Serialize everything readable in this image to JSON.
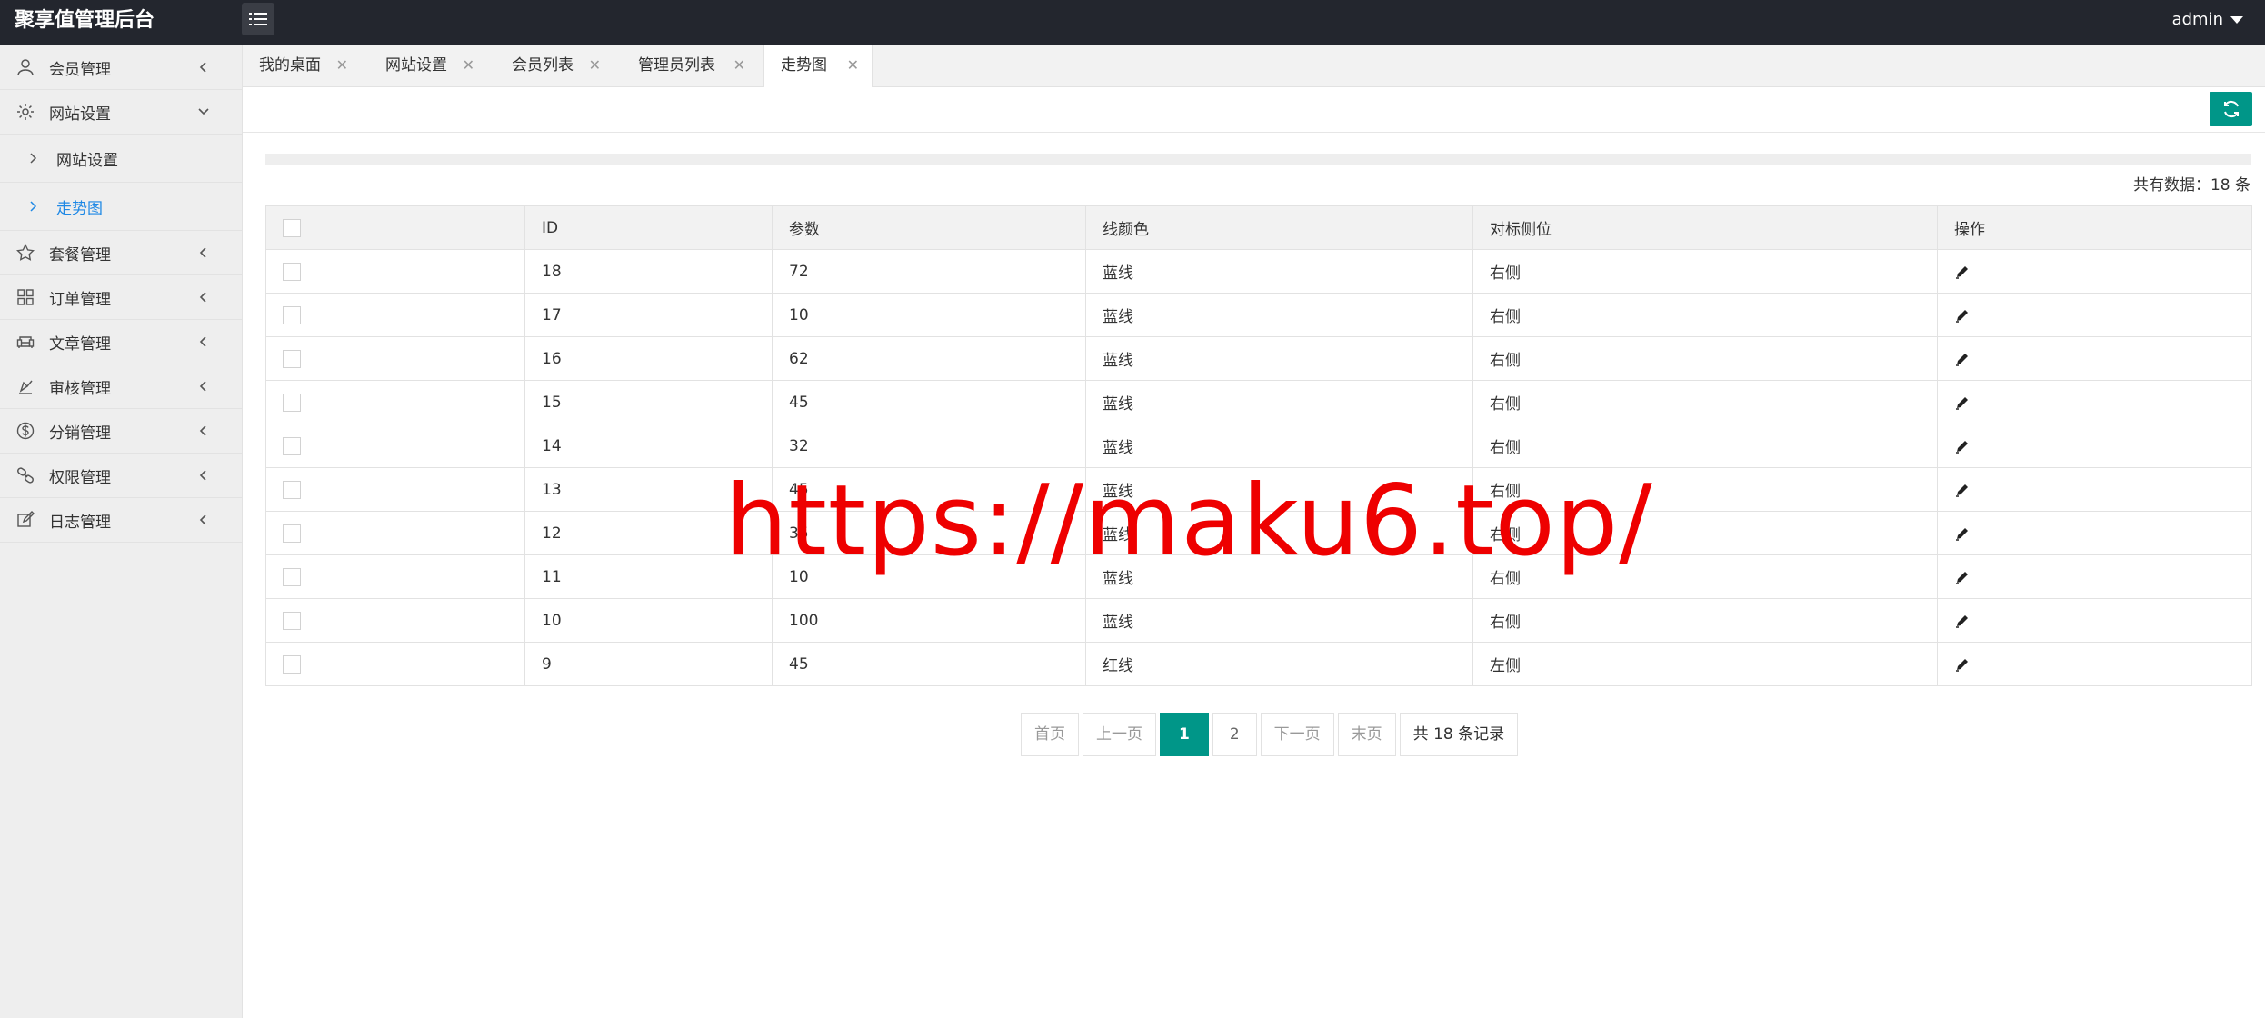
{
  "header": {
    "title": "聚享值管理后台",
    "user": "admin"
  },
  "sidebar": {
    "items": [
      {
        "label": "会员管理",
        "icon": "user-icon"
      },
      {
        "label": "网站设置",
        "icon": "gear-icon",
        "expanded": true
      },
      {
        "label": "套餐管理",
        "icon": "star-icon"
      },
      {
        "label": "订单管理",
        "icon": "grid-icon"
      },
      {
        "label": "文章管理",
        "icon": "sofa-icon"
      },
      {
        "label": "审核管理",
        "icon": "approve-icon"
      },
      {
        "label": "分销管理",
        "icon": "dollar-icon"
      },
      {
        "label": "权限管理",
        "icon": "link-icon"
      },
      {
        "label": "日志管理",
        "icon": "edit-log-icon"
      }
    ],
    "sub_items": [
      {
        "label": "网站设置",
        "active": false
      },
      {
        "label": "走势图",
        "active": true
      }
    ]
  },
  "tabs": [
    {
      "label": "我的桌面",
      "close": "✕"
    },
    {
      "label": "网站设置",
      "close": "✕"
    },
    {
      "label": "会员列表",
      "close": "✕"
    },
    {
      "label": "管理员列表",
      "close": "✕"
    },
    {
      "label": "走势图",
      "close": "✕",
      "active": true
    }
  ],
  "summary": {
    "total_text": "共有数据：18 条"
  },
  "table": {
    "headers": [
      "ID",
      "参数",
      "线颜色",
      "对标侧位",
      "操作"
    ],
    "rows": [
      {
        "id": "18",
        "param": "72",
        "color": "蓝线",
        "side": "右侧"
      },
      {
        "id": "17",
        "param": "10",
        "color": "蓝线",
        "side": "右侧"
      },
      {
        "id": "16",
        "param": "62",
        "color": "蓝线",
        "side": "右侧"
      },
      {
        "id": "15",
        "param": "45",
        "color": "蓝线",
        "side": "右侧"
      },
      {
        "id": "14",
        "param": "32",
        "color": "蓝线",
        "side": "右侧"
      },
      {
        "id": "13",
        "param": "45",
        "color": "蓝线",
        "side": "右侧"
      },
      {
        "id": "12",
        "param": "35",
        "color": "蓝线",
        "side": "右侧"
      },
      {
        "id": "11",
        "param": "10",
        "color": "蓝线",
        "side": "右侧"
      },
      {
        "id": "10",
        "param": "100",
        "color": "蓝线",
        "side": "右侧"
      },
      {
        "id": "9",
        "param": "45",
        "color": "红线",
        "side": "左侧"
      }
    ]
  },
  "pagination": {
    "first": "首页",
    "prev": "上一页",
    "pages": [
      "1",
      "2"
    ],
    "current": "1",
    "next": "下一页",
    "last": "末页",
    "count": "共 18 条记录"
  },
  "watermark": "https://maku6.top/",
  "colors": {
    "header_bg": "#23262e",
    "accent": "#009688",
    "active_link": "#1e88e5",
    "watermark": "#ee0000"
  }
}
